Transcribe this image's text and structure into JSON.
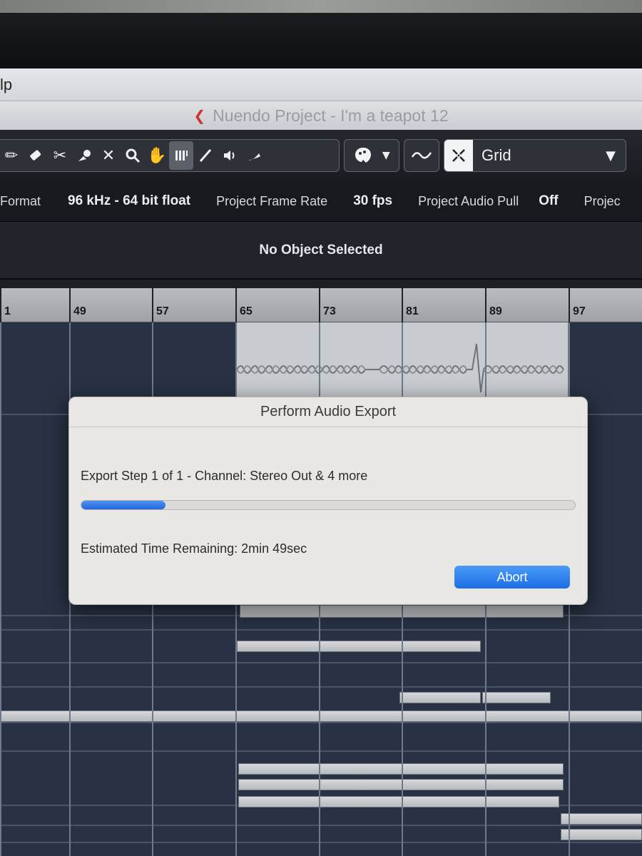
{
  "menubar": {
    "menu_fragment": "lp"
  },
  "window": {
    "title": "Nuendo Project - I'm a teapot 12",
    "app_icon": "nuendo-logo-icon"
  },
  "toolbar": {
    "tools": [
      "eraser-icon",
      "scissors-icon",
      "glue-icon",
      "mute-x-icon",
      "zoom-icon",
      "hand-icon",
      "comp-icon",
      "line-icon",
      "speaker-icon",
      "warp-icon"
    ],
    "snap_mode": "Grid"
  },
  "infoline": {
    "format_label": "Format",
    "format_value": "96 kHz - 64 bit float",
    "frame_rate_label": "Project Frame Rate",
    "frame_rate_value": "30 fps",
    "audio_pull_label": "Project Audio Pull",
    "audio_pull_value": "Off",
    "project_truncated": "Projec"
  },
  "selection": {
    "message": "No Object Selected"
  },
  "ruler": {
    "bars": [
      "1",
      "49",
      "57",
      "65",
      "73",
      "81",
      "89",
      "97"
    ]
  },
  "dialog": {
    "title": "Perform Audio Export",
    "step_text": "Export Step 1 of 1  - Channel: Stereo Out & 4 more",
    "progress": 0.17,
    "eta_text": "Estimated Time Remaining: 2min 49sec",
    "abort_label": "Abort"
  },
  "colors": {
    "accent": "#2367db",
    "toolbar_bg": "#1f2227",
    "arrange_bg": "#283244"
  }
}
